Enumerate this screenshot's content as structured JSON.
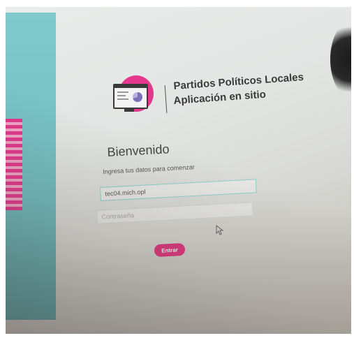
{
  "brand": {
    "title": "Partidos Políticos Locales",
    "subtitle": "Aplicación en sitio",
    "accent_color": "#e4388d",
    "panel_color": "#7fc9cc",
    "logo_icon": "monitor-pie-chart-icon"
  },
  "login": {
    "heading": "Bienvenido",
    "instructions": "Ingresa tus datos para comenzar",
    "username_value": "tec04.mich.opl",
    "password_placeholder": "Contraseña",
    "submit_label": "Entrar"
  },
  "cursor": {
    "icon": "mouse-pointer-icon"
  }
}
